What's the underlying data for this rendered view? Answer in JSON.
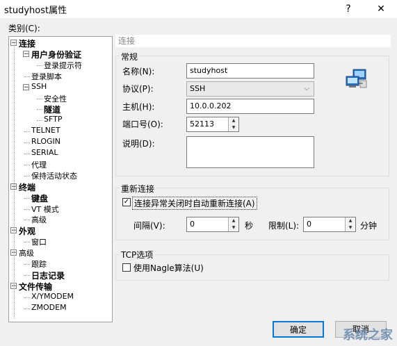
{
  "window": {
    "title": "studyhost属性",
    "help": "?",
    "close": "✕"
  },
  "category_label": "类别(C):",
  "tree": [
    {
      "label": "连接",
      "bold": true
    },
    {
      "label": "用户身份验证",
      "bold": true
    },
    {
      "label": "登录提示符",
      "bold": false
    },
    {
      "label": "登录脚本",
      "bold": false
    },
    {
      "label": "SSH",
      "bold": false
    },
    {
      "label": "安全性",
      "bold": false
    },
    {
      "label": "隧道",
      "bold": true
    },
    {
      "label": "SFTP",
      "bold": false
    },
    {
      "label": "TELNET",
      "bold": false
    },
    {
      "label": "RLOGIN",
      "bold": false
    },
    {
      "label": "SERIAL",
      "bold": false
    },
    {
      "label": "代理",
      "bold": false
    },
    {
      "label": "保持活动状态",
      "bold": false
    },
    {
      "label": "终端",
      "bold": true
    },
    {
      "label": "键盘",
      "bold": true
    },
    {
      "label": "VT 模式",
      "bold": false
    },
    {
      "label": "高级",
      "bold": false
    },
    {
      "label": "外观",
      "bold": true
    },
    {
      "label": "窗口",
      "bold": false
    },
    {
      "label": "高级",
      "bold": false
    },
    {
      "label": "跟踪",
      "bold": false
    },
    {
      "label": "日志记录",
      "bold": true
    },
    {
      "label": "文件传输",
      "bold": true
    },
    {
      "label": "X/YMODEM",
      "bold": false
    },
    {
      "label": "ZMODEM",
      "bold": false
    }
  ],
  "section_title": "连接",
  "general": {
    "group_label": "常规",
    "name_label": "名称(N):",
    "name_value": "studyhost",
    "protocol_label": "协议(P):",
    "protocol_value": "SSH",
    "host_label": "主机(H):",
    "host_value": "10.0.0.202",
    "port_label": "端口号(O):",
    "port_value": "52113",
    "desc_label": "说明(D):",
    "desc_value": ""
  },
  "reconnect": {
    "group_label": "重新连接",
    "auto_label": "连接异常关闭时自动重新连接(A)",
    "auto_checked": true,
    "interval_label": "间隔(V):",
    "interval_value": "0",
    "sec": "秒",
    "limit_label": "限制(L):",
    "limit_value": "0",
    "min": "分钟"
  },
  "tcp": {
    "group_label": "TCP选项",
    "nagle_label": "使用Nagle算法(U)",
    "nagle_checked": false
  },
  "buttons": {
    "ok": "确定",
    "cancel": "取消"
  },
  "watermark": "系统之家"
}
